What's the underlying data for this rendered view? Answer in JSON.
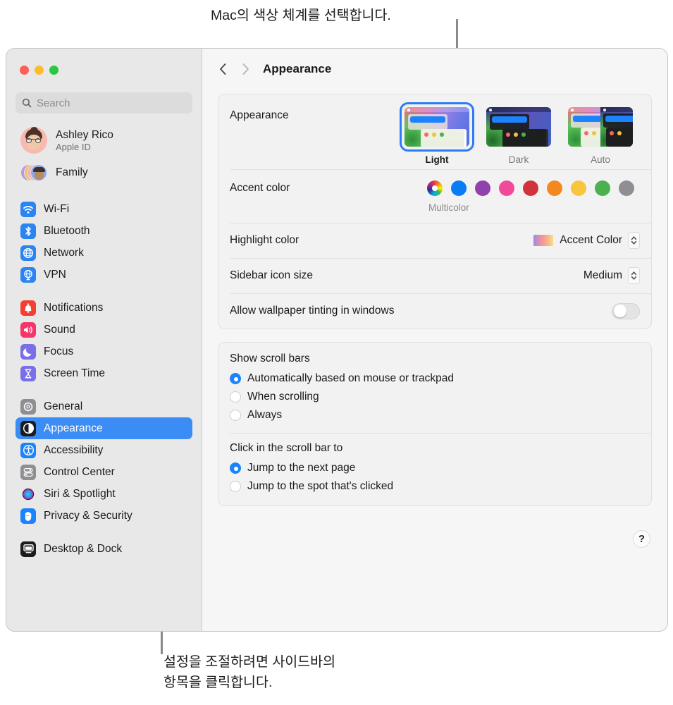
{
  "callouts": {
    "top": "Mac의 색상 체계를 선택합니다.",
    "bottom_line1": "설정을 조절하려면 사이드바의",
    "bottom_line2": "항목을 클릭합니다."
  },
  "window": {
    "traffic_lights": [
      "close-button",
      "minimize-button",
      "zoom-button"
    ],
    "colors": {
      "close": "#ff5f56",
      "minimize": "#fdbc2e",
      "zoom": "#26c940",
      "accent": "#3c8cf5"
    }
  },
  "sidebar": {
    "search": {
      "placeholder": "Search",
      "value": "",
      "icon": "search-icon"
    },
    "account": {
      "name": "Ashley Rico",
      "subtitle": "Apple ID",
      "avatar": "memoji-avatar"
    },
    "family": {
      "label": "Family",
      "avatar": "family-avatars"
    },
    "groups": [
      {
        "items": [
          {
            "label": "Wi-Fi",
            "icon": "wifi-icon",
            "color": "#2a84f2",
            "selected": false
          },
          {
            "label": "Bluetooth",
            "icon": "bluetooth-icon",
            "color": "#2a84f2",
            "selected": false
          },
          {
            "label": "Network",
            "icon": "globe-icon",
            "color": "#2a84f2",
            "selected": false
          },
          {
            "label": "VPN",
            "icon": "vpn-globe-icon",
            "color": "#2a84f2",
            "selected": false
          }
        ]
      },
      {
        "items": [
          {
            "label": "Notifications",
            "icon": "bell-icon",
            "color": "#f4402f",
            "selected": false
          },
          {
            "label": "Sound",
            "icon": "speaker-icon",
            "color": "#f5366a",
            "selected": false
          },
          {
            "label": "Focus",
            "icon": "moon-icon",
            "color": "#7a6fe8",
            "selected": false
          },
          {
            "label": "Screen Time",
            "icon": "hourglass-icon",
            "color": "#7a6fe8",
            "selected": false
          }
        ]
      },
      {
        "items": [
          {
            "label": "General",
            "icon": "gear-icon",
            "color": "#8e8e93",
            "selected": false
          },
          {
            "label": "Appearance",
            "icon": "appearance-icon",
            "color": "#1c1c1e",
            "selected": true
          },
          {
            "label": "Accessibility",
            "icon": "accessibility-icon",
            "color": "#1b83fb",
            "selected": false
          },
          {
            "label": "Control Center",
            "icon": "control-center-icon",
            "color": "#8e8e93",
            "selected": false
          },
          {
            "label": "Siri & Spotlight",
            "icon": "siri-icon",
            "color": "#2b1b2e",
            "selected": false
          },
          {
            "label": "Privacy & Security",
            "icon": "hand-icon",
            "color": "#1b83fb",
            "selected": false
          }
        ]
      },
      {
        "items": [
          {
            "label": "Desktop & Dock",
            "icon": "desktop-dock-icon",
            "color": "#1c1c1e",
            "selected": false
          }
        ]
      }
    ]
  },
  "toolbar": {
    "back_icon": "chevron-left-icon",
    "forward_icon": "chevron-right-icon",
    "title": "Appearance"
  },
  "appearance_pane": {
    "appearance": {
      "label": "Appearance",
      "options": [
        {
          "label": "Light",
          "selected": true
        },
        {
          "label": "Dark",
          "selected": false
        },
        {
          "label": "Auto",
          "selected": false
        }
      ]
    },
    "accent_color": {
      "label": "Accent color",
      "caption": "Multicolor",
      "swatches": [
        {
          "name": "multicolor",
          "color": "multicolor",
          "selected": true
        },
        {
          "name": "blue",
          "color": "#0a7cf6",
          "selected": false
        },
        {
          "name": "purple",
          "color": "#9141ac",
          "selected": false
        },
        {
          "name": "pink",
          "color": "#f04a9b",
          "selected": false
        },
        {
          "name": "red",
          "color": "#d0343a",
          "selected": false
        },
        {
          "name": "orange",
          "color": "#f2881f",
          "selected": false
        },
        {
          "name": "yellow",
          "color": "#f7c залив",
          "selected": false
        },
        {
          "name": "green",
          "color": "#4cb050",
          "selected": false
        },
        {
          "name": "graphite",
          "color": "#8e8e93",
          "selected": false
        }
      ]
    },
    "highlight_color": {
      "label": "Highlight color",
      "value": "Accent Color"
    },
    "sidebar_icon_size": {
      "label": "Sidebar icon size",
      "value": "Medium"
    },
    "wallpaper_tinting": {
      "label": "Allow wallpaper tinting in windows",
      "enabled": false
    }
  },
  "scroll_pane": {
    "show_scroll_bars": {
      "heading": "Show scroll bars",
      "options": [
        {
          "label": "Automatically based on mouse or trackpad",
          "selected": true
        },
        {
          "label": "When scrolling",
          "selected": false
        },
        {
          "label": "Always",
          "selected": false
        }
      ]
    },
    "click_scroll_bar": {
      "heading": "Click in the scroll bar to",
      "options": [
        {
          "label": "Jump to the next page",
          "selected": true
        },
        {
          "label": "Jump to the spot that's clicked",
          "selected": false
        }
      ]
    },
    "help_label": "?"
  }
}
